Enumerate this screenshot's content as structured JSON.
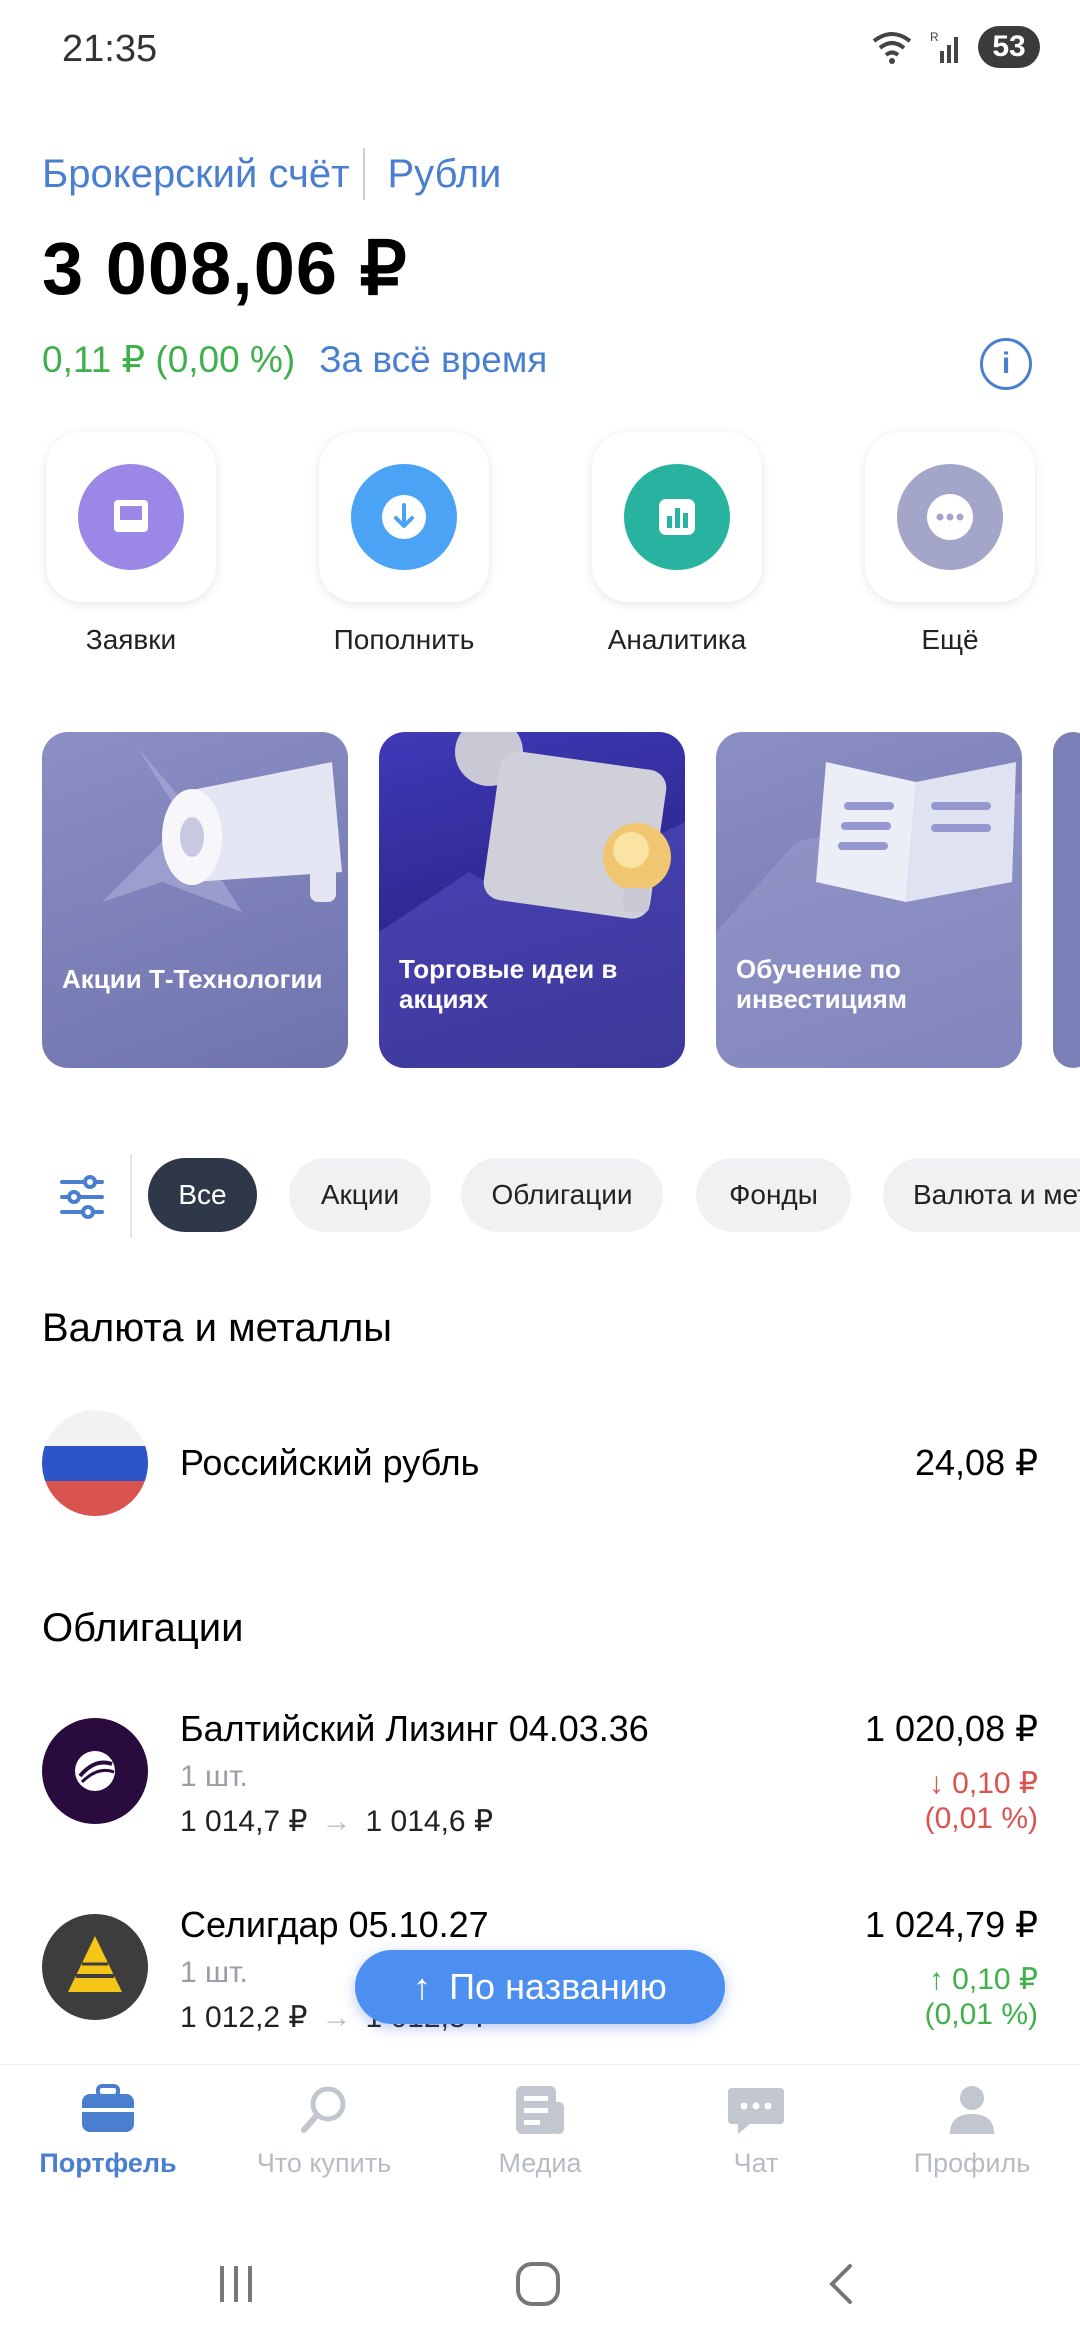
{
  "status_bar": {
    "time": "21:35",
    "battery": "53"
  },
  "header": {
    "account": "Брокерский счёт",
    "currency": "Рубли",
    "balance": "3 008,06 ₽",
    "pnl": "0,11 ₽ (0,00 %)",
    "pnl_period": "За всё время",
    "info_icon": "i"
  },
  "quick_actions": [
    {
      "label": "Заявки",
      "icon": "orders-icon",
      "color": "#9b87e6"
    },
    {
      "label": "Пополнить",
      "icon": "deposit-icon",
      "color": "#4aa3f5"
    },
    {
      "label": "Аналитика",
      "icon": "analytics-icon",
      "color": "#27b3a0"
    },
    {
      "label": "Ещё",
      "icon": "more-icon",
      "color": "#a3a6c8"
    }
  ],
  "promos": [
    {
      "text": "Акции Т‑Технологии"
    },
    {
      "text": "Торговые идеи в акциях"
    },
    {
      "text": "Обучение по инвестициям"
    }
  ],
  "filters": [
    "Все",
    "Акции",
    "Облигации",
    "Фонды",
    "Валюта и мет"
  ],
  "sections": {
    "currency": {
      "title": "Валюта и металлы",
      "item": {
        "name": "Российский рубль",
        "value": "24,08 ₽"
      }
    },
    "bonds": {
      "title": "Облигации",
      "items": [
        {
          "name": "Балтийский Лизинг 04.03.36",
          "qty": "1 шт.",
          "price_from": "1 014,7 ₽",
          "price_to": "1 014,6 ₽",
          "value": "1 020,08 ₽",
          "change": "↓ 0,10 ₽",
          "change_pct": "(0,01 %)",
          "change_color": "#d9534f"
        },
        {
          "name": "Селигдар 05.10.27",
          "qty": "1 шт.",
          "price_from": "1 012,2 ₽",
          "price_to": "1 012,3 ₽",
          "value": "1 024,79 ₽",
          "change": "↑ 0,10 ₽",
          "change_pct": "(0,01 %)",
          "change_color": "#3fb04c"
        }
      ]
    }
  },
  "fab": {
    "label": "По названию",
    "arrow": "↑"
  },
  "bottom_nav": [
    {
      "label": "Портфель",
      "icon": "briefcase-icon",
      "active": true
    },
    {
      "label": "Что купить",
      "icon": "search-icon",
      "active": false
    },
    {
      "label": "Медиа",
      "icon": "newspaper-icon",
      "active": false
    },
    {
      "label": "Чат",
      "icon": "chat-icon",
      "active": false
    },
    {
      "label": "Профиль",
      "icon": "profile-icon",
      "active": false
    }
  ]
}
